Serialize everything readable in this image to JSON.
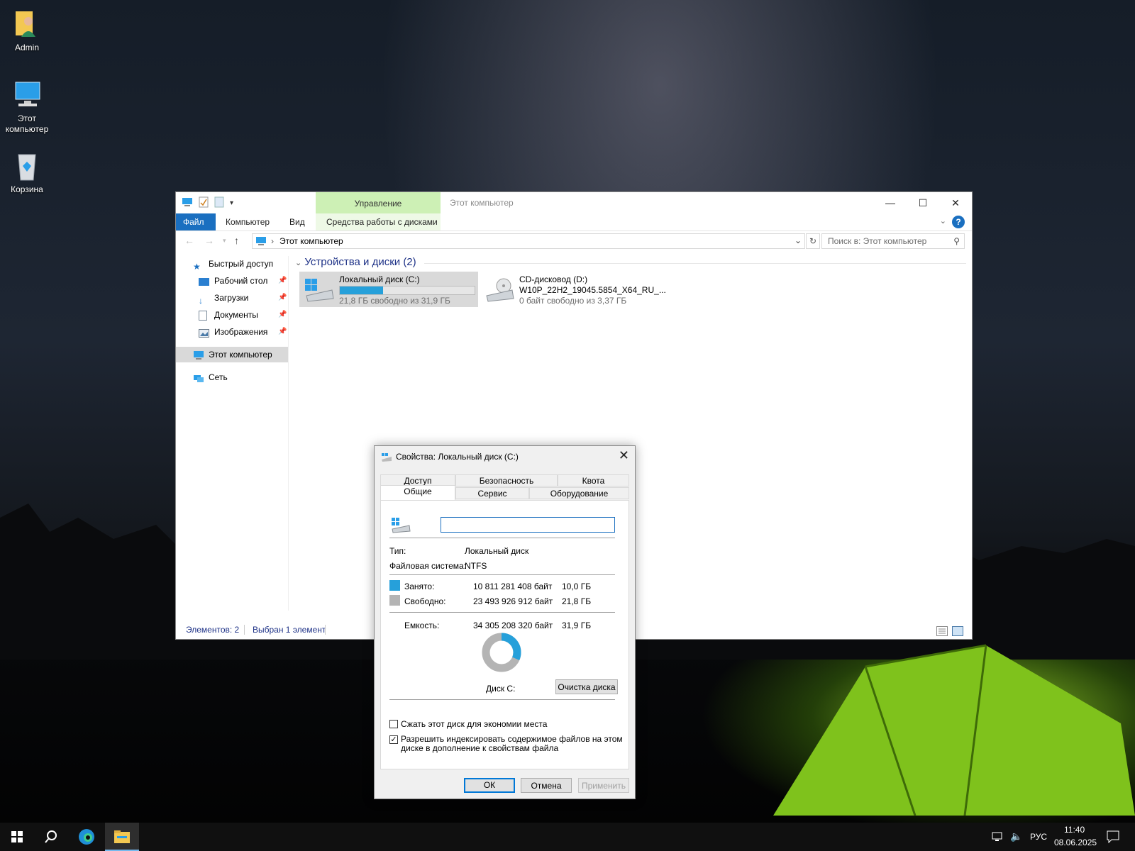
{
  "desktop": {
    "icons": [
      {
        "label": "Admin"
      },
      {
        "label": "Этот компьютер"
      },
      {
        "label": "Корзина"
      }
    ]
  },
  "explorer": {
    "context_tab": "Управление",
    "window_title": "Этот компьютер",
    "ribbon_tabs": [
      "Файл",
      "Компьютер",
      "Вид",
      "Средства работы с дисками"
    ],
    "address": "Этот компьютер",
    "search_placeholder": "Поиск в: Этот компьютер",
    "sidebar": {
      "quick_access": "Быстрый доступ",
      "items": [
        {
          "label": "Рабочий стол"
        },
        {
          "label": "Загрузки"
        },
        {
          "label": "Документы"
        },
        {
          "label": "Изображения"
        }
      ],
      "this_pc": "Этот компьютер",
      "network": "Сеть"
    },
    "group_header": "Устройства и диски (2)",
    "drives": [
      {
        "name": "Локальный диск (C:)",
        "free": "21,8 ГБ свободно из 31,9 ГБ",
        "used_fraction": 0.32
      },
      {
        "name": "CD-дисковод (D:)",
        "subtitle": "W10P_22H2_19045.5854_X64_RU_...",
        "free": "0 байт свободно из 3,37 ГБ"
      }
    ],
    "status": {
      "items": "Элементов: 2",
      "selected": "Выбран 1 элемент"
    }
  },
  "dialog": {
    "title": "Свойства: Локальный диск (C:)",
    "tabs_back": [
      "Доступ",
      "Безопасность",
      "Квота"
    ],
    "tabs_front": [
      "Общие",
      "Сервис",
      "Оборудование"
    ],
    "name_value": "",
    "type_label": "Тип:",
    "type_value": "Локальный диск",
    "fs_label": "Файловая система:",
    "fs_value": "NTFS",
    "used_label": "Занято:",
    "used_bytes": "10 811 281 408 байт",
    "used_gb": "10,0 ГБ",
    "free_label": "Свободно:",
    "free_bytes": "23 493 926 912 байт",
    "free_gb": "21,8 ГБ",
    "capacity_label": "Емкость:",
    "capacity_bytes": "34 305 208 320 байт",
    "capacity_gb": "31,9 ГБ",
    "used_fraction": 0.315,
    "disk_label": "Диск С:",
    "cleanup_button": "Очистка диска",
    "compress_label": "Сжать этот диск для экономии места",
    "compress_checked": false,
    "index_label_line1": "Разрешить индексировать содержимое файлов на этом",
    "index_label_line2": "диске в дополнение к свойствам файла",
    "index_checked": true,
    "ok": "ОК",
    "cancel": "Отмена",
    "apply": "Применить",
    "colors": {
      "used": "#26a0da",
      "free": "#b4b4b4"
    }
  },
  "taskbar": {
    "lang": "РУС",
    "time": "11:40",
    "date": "08.06.2025"
  }
}
